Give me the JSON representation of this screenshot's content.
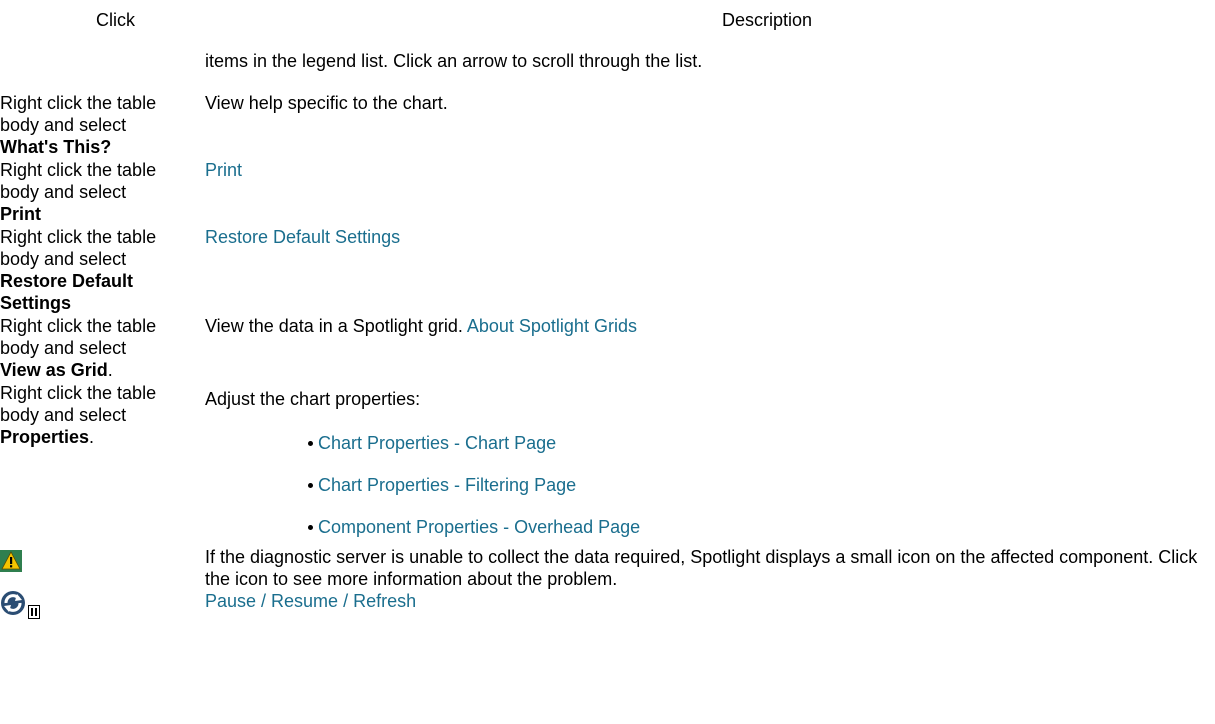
{
  "header": {
    "click": "Click",
    "description": "Description"
  },
  "rows": [
    {
      "description": "items in the legend list. Click an arrow to scroll through the list."
    },
    {
      "click_prefix": "Right click the table body and select",
      "click_bold": "What's This?",
      "description": "View help specific to the chart."
    },
    {
      "click_prefix": "Right click the table body and select",
      "click_bold": "Print",
      "link": "Print"
    },
    {
      "click_prefix": "Right click the table body and select",
      "click_bold": "Restore Default Settings",
      "link": "Restore Default Settings"
    },
    {
      "click_prefix": "Right click the table body and select",
      "click_bold": "View as Grid",
      "click_suffix": ".",
      "description": "View the data in a Spotlight grid.",
      "link": "About Spotlight Grids"
    },
    {
      "click_prefix": "Right click the table body and select",
      "click_bold": "Properties",
      "click_suffix": ".",
      "description": "Adjust the chart properties:",
      "links": [
        "Chart Properties - Chart Page",
        "Chart Properties - Filtering Page",
        "Component Properties - Overhead Page"
      ]
    },
    {
      "icon": "warning-icon",
      "description": "If the diagnostic server is unable to collect the data required, Spotlight displays a small icon on the affected component. Click the icon to see more information about the problem."
    },
    {
      "icons": [
        "refresh-icon",
        "pause-icon"
      ],
      "link": "Pause / Resume / Refresh"
    }
  ],
  "colors": {
    "link": "#1a6e8e",
    "warning_bg": "#2f7f4f",
    "warning_triangle": "#f5c400"
  }
}
